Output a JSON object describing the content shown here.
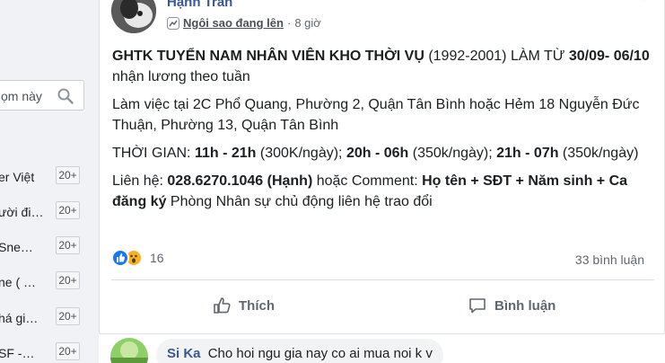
{
  "sidebar": {
    "search": {
      "value": "ọm này"
    },
    "groups": [
      {
        "name": "er Việt",
        "badge": "20+"
      },
      {
        "name": "ười đi…",
        "badge": "20+"
      },
      {
        "name": "Sne…",
        "badge": "20+"
      },
      {
        "name": "ne ( …",
        "badge": "20+"
      },
      {
        "name": "há gi…",
        "badge": "20+"
      },
      {
        "name": "SF -…",
        "badge": "20+"
      }
    ]
  },
  "post": {
    "author": "Hạnh Trần",
    "badge": "Ngôi sao đang lên",
    "separator": "·",
    "time": "8 giờ",
    "lines": {
      "p1_bold": "GHTK TUYỂN NAM NHÂN VIÊN KHO THỜI VỤ",
      "p1_mid": " (1992-2001) LÀM TỪ ",
      "p1_bold2": "30/09- 06/10",
      "p1_end": " nhận lương theo tuần",
      "p2": "Làm việc tại 2C Phổ Quang, Phường 2, Quận Tân Bình hoặc Hẻm 18 Nguyễn Đức Thuận, Phường 13, Quận Tân Bình",
      "p3_a": "THỜI GIAN: ",
      "p3_b": "11h - 21h",
      "p3_c": " (300K/ngày); ",
      "p3_d": "20h - 06h",
      "p3_e": " (350k/ngày); ",
      "p3_f": "21h - 07h",
      "p3_g": " (350k/ngày)",
      "p4_a": "Liên hệ: ",
      "p4_b": "028.6270.1046 (Hạnh)",
      "p4_c": " hoặc Comment: ",
      "p4_d": "Họ tên + SĐT + Năm sinh + Ca đăng ký",
      "p4_e": " Phòng Nhân sự chủ động liên hệ trao đổi"
    },
    "reaction_count": "16",
    "comment_count": "33 bình luận",
    "actions": {
      "like": "Thích",
      "comment": "Bình luận"
    }
  },
  "comment": {
    "author": "Si Ka",
    "text": "Cho hoi ngu gia nay co ai mua noi k v"
  },
  "colors": {
    "link": "#385898",
    "like_blue": "#1877f2",
    "wow_yellow": "#f7b125"
  }
}
